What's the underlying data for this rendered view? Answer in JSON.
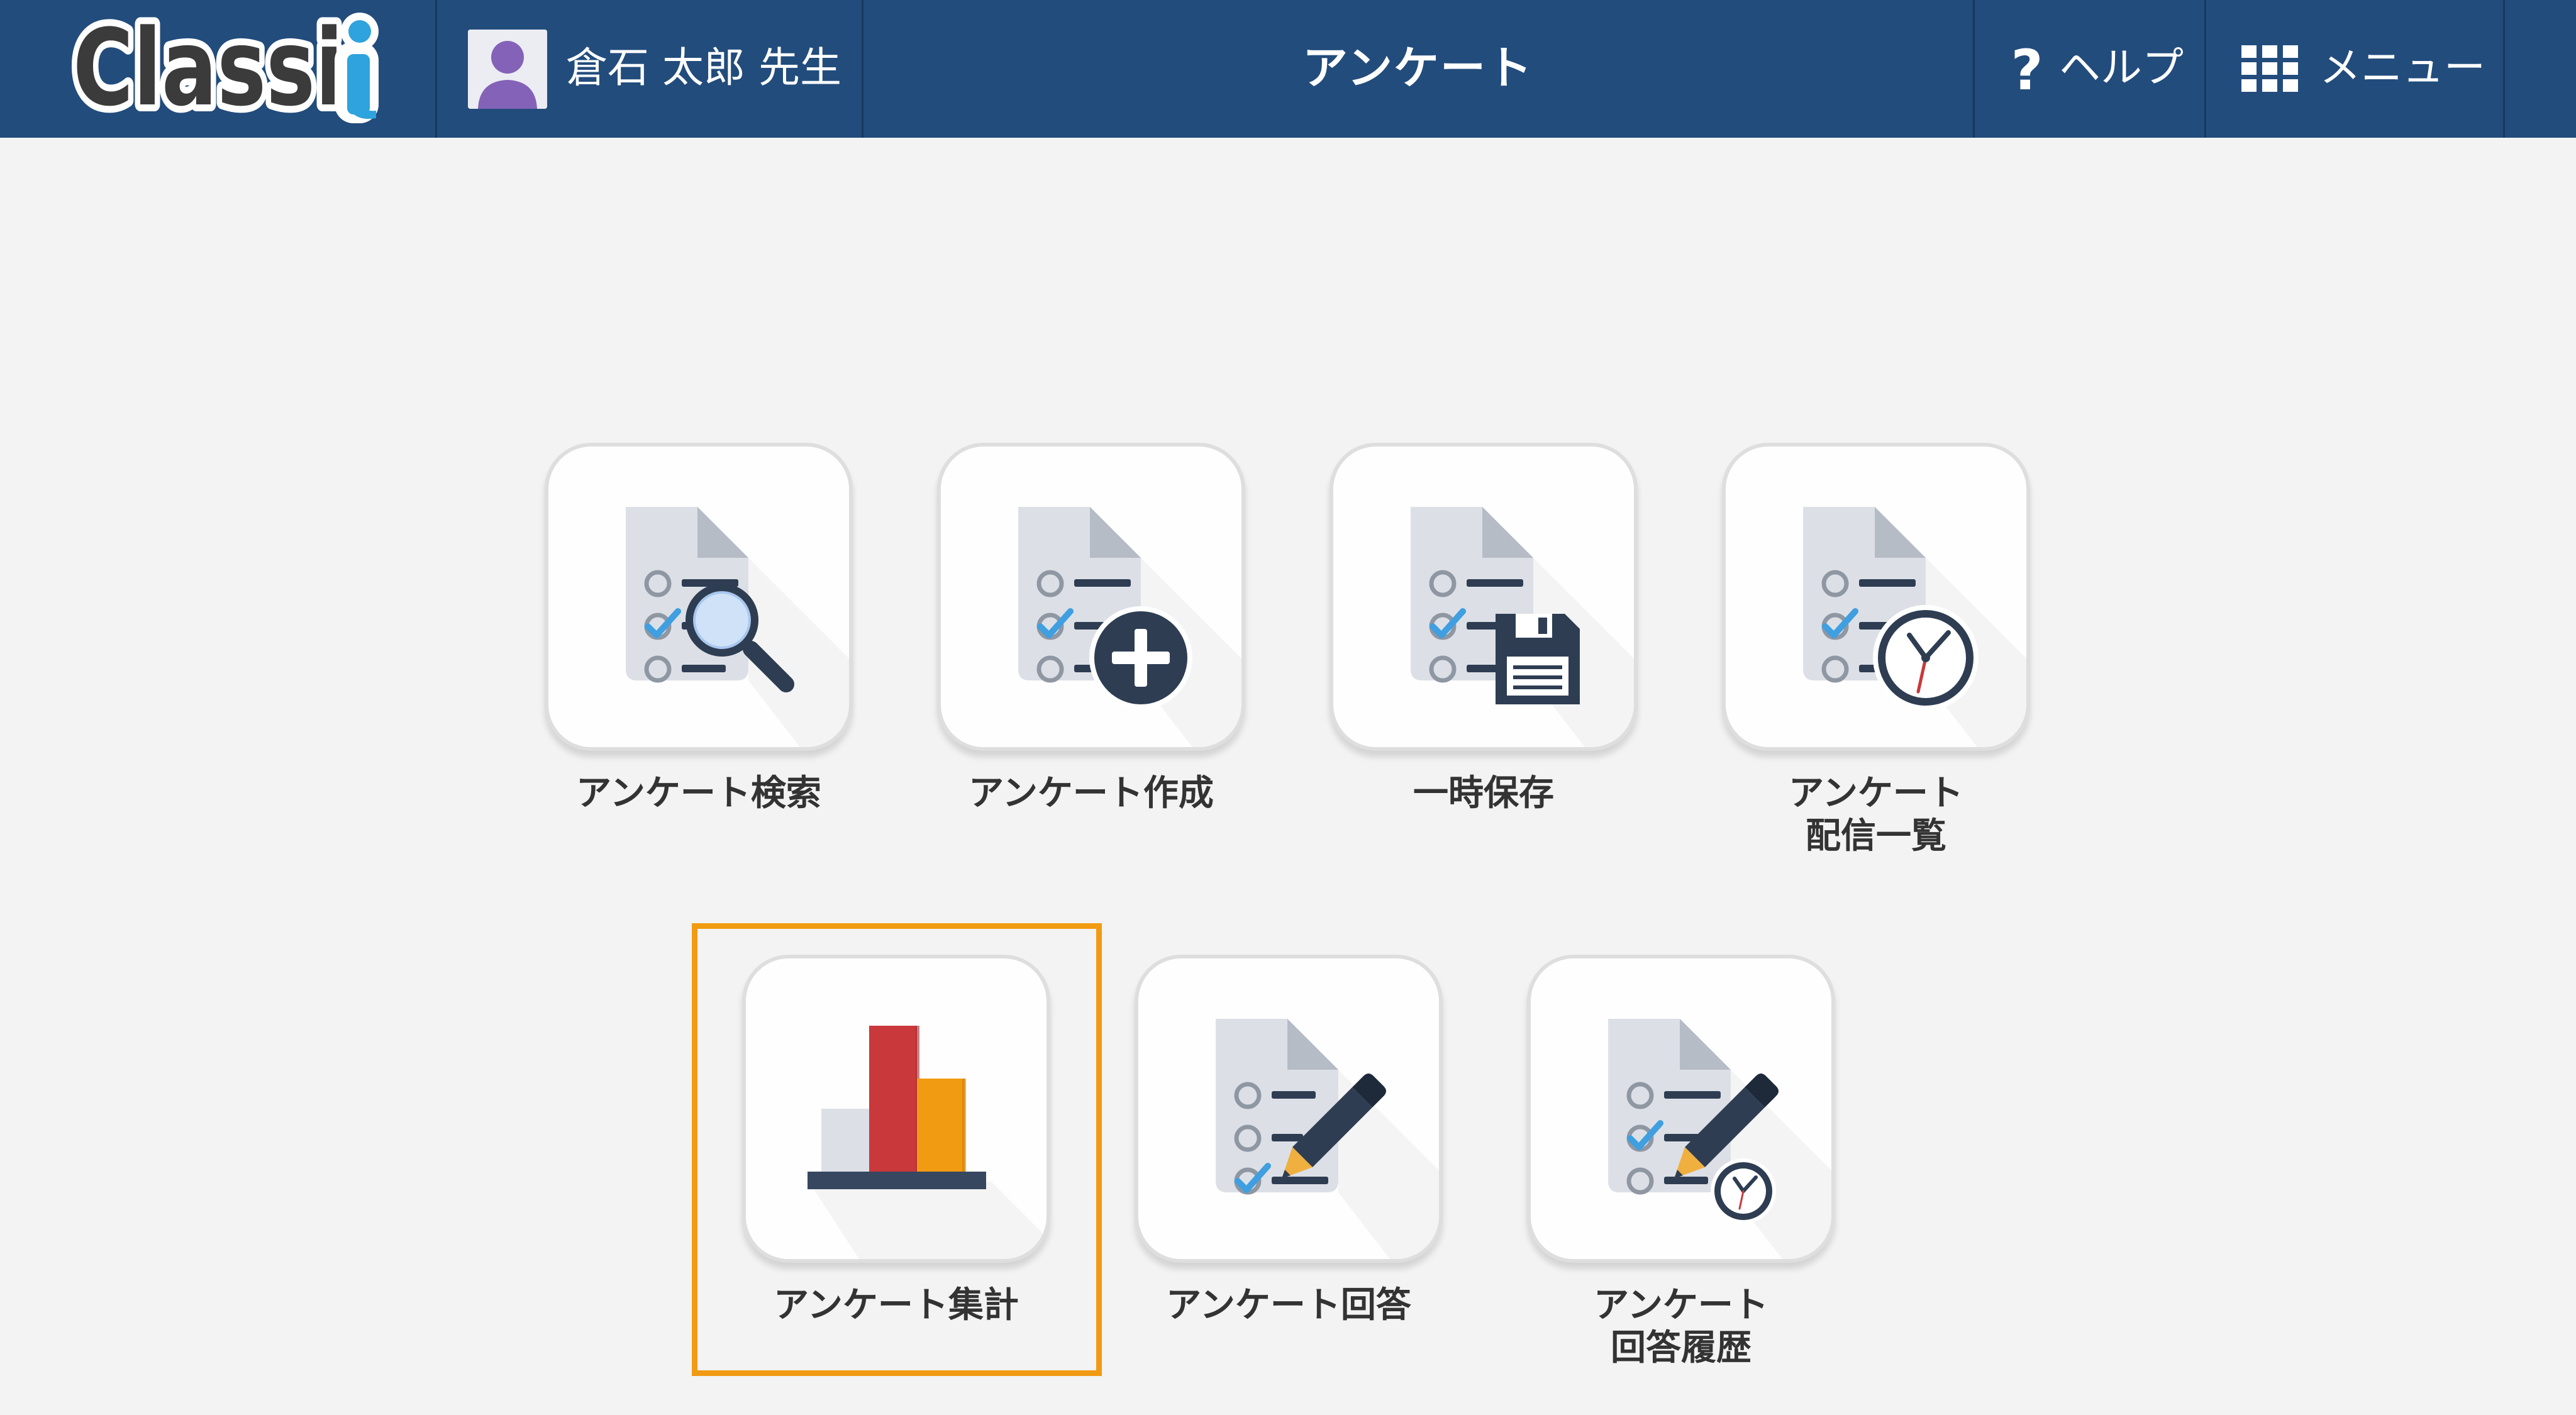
{
  "header": {
    "logo_text": "Classi",
    "user_name": "倉石 太郎 先生",
    "title": "アンケート",
    "help_label": "ヘルプ",
    "menu_label": "メニュー"
  },
  "colors": {
    "header_bg": "#224c7c",
    "page_bg": "#f3f3f3",
    "selection_border": "#f19b12"
  },
  "tiles": [
    {
      "label": "アンケート検索",
      "icon": "survey-search-icon"
    },
    {
      "label": "アンケート作成",
      "icon": "survey-create-icon"
    },
    {
      "label": "一時保存",
      "icon": "survey-save-icon"
    },
    {
      "label": "アンケート\n配信一覧",
      "icon": "survey-distribution-list-icon"
    },
    {
      "label": "アンケート集計",
      "icon": "survey-aggregate-icon",
      "selected": true
    },
    {
      "label": "アンケート回答",
      "icon": "survey-answer-icon"
    },
    {
      "label": "アンケート\n回答履歴",
      "icon": "survey-answer-history-icon"
    }
  ]
}
